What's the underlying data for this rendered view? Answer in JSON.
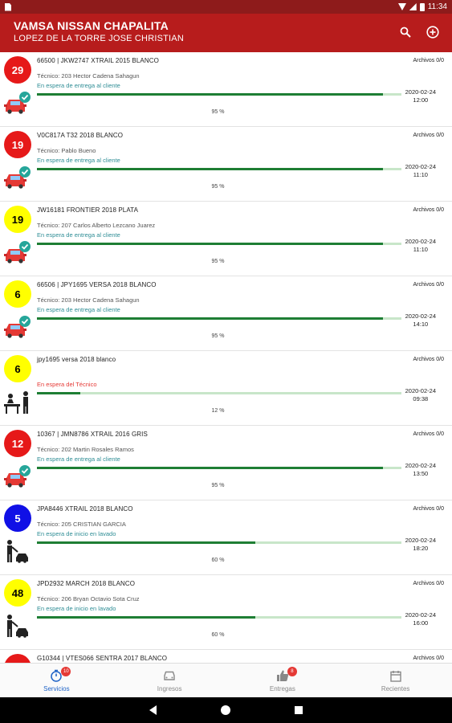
{
  "status_bar": {
    "time": "11:34"
  },
  "appbar": {
    "title": "VAMSA NISSAN CHAPALITA",
    "subtitle": "LOPEZ DE LA TORRE JOSE CHRISTIAN",
    "search_icon": "search-icon",
    "add_icon": "add-circle-icon"
  },
  "rows": [
    {
      "badge": "29",
      "badge_color": "#e61919",
      "vehicle": "66500  |  JKW2747 XTRAIL 2015 BLANCO",
      "tecnico": "Técnico: 203 Hector Cadena Sahagun",
      "estado": "En espera de entrega al cliente",
      "fecha": "2020-02-24",
      "hora": "12:00",
      "porcentaje": "95 %",
      "progress": 0.95,
      "archivos": "Archivos 0/0",
      "icon": "car-done-icon"
    },
    {
      "badge": "19",
      "badge_color": "#e61919",
      "vehicle": "V0C817A T32 2018 BLANCO",
      "tecnico": "Técnico: Pablo Bueno",
      "estado": "En espera de entrega al cliente",
      "fecha": "2020-02-24",
      "hora": "11:10",
      "porcentaje": "95 %",
      "progress": 0.95,
      "archivos": "Archivos 0/0",
      "icon": "car-done-icon"
    },
    {
      "badge": "19",
      "badge_color": "#ffff00",
      "vehicle": "JW16181 FRONTIER 2018 PLATA",
      "tecnico": "Técnico: 207 Carlos Alberto Lezcano Juarez",
      "estado": "En espera de entrega al cliente",
      "fecha": "2020-02-24",
      "hora": "11:10",
      "porcentaje": "95 %",
      "progress": 0.95,
      "archivos": "Archivos 0/0",
      "icon": "car-done-icon"
    },
    {
      "badge": "6",
      "badge_color": "#ffff00",
      "vehicle": "66506  |  JPY1695 VERSA 2018 BLANCO",
      "tecnico": "Técnico: 203 Hector Cadena Sahagun",
      "estado": "En espera de entrega al cliente",
      "fecha": "2020-02-24",
      "hora": "14:10",
      "porcentaje": "95 %",
      "progress": 0.95,
      "archivos": "Archivos 0/0",
      "icon": "car-done-icon"
    },
    {
      "badge": "6",
      "badge_color": "#ffff00",
      "vehicle": "jpy1695 versa 2018 blanco",
      "tecnico": "",
      "estado": "En espera del Técnico",
      "estado_red": true,
      "fecha": "2020-02-24",
      "hora": "09:38",
      "porcentaje": "12 %",
      "progress": 0.12,
      "archivos": "Archivos 0/0",
      "icon": "reception-desk-icon"
    },
    {
      "badge": "12",
      "badge_color": "#e61919",
      "vehicle": "10367  |  JMN8786 XTRAIL 2016 GRIS",
      "tecnico": "Técnico: 202 Martin Rosales Ramos",
      "estado": "En espera de entrega al cliente",
      "fecha": "2020-02-24",
      "hora": "13:50",
      "porcentaje": "95 %",
      "progress": 0.95,
      "archivos": "Archivos 0/0",
      "icon": "car-done-icon"
    },
    {
      "badge": "5",
      "badge_color": "#1010e6",
      "vehicle": "JPA8446 XTRAIL 2018 BLANCO",
      "tecnico": "Técnico: 205 CRISTIAN GARCIA",
      "estado": "En espera de inicio en lavado",
      "fecha": "2020-02-24",
      "hora": "18:20",
      "porcentaje": "60 %",
      "progress": 0.6,
      "archivos": "Archivos 0/0",
      "icon": "car-wash-icon"
    },
    {
      "badge": "48",
      "badge_color": "#ffff00",
      "vehicle": "JPD2932 MARCH 2018 BLANCO",
      "tecnico": "Técnico: 206 Bryan Octavio Sota Cruz",
      "estado": "En espera de inicio en lavado",
      "fecha": "2020-02-24",
      "hora": "16:00",
      "porcentaje": "60 %",
      "progress": 0.6,
      "archivos": "Archivos 0/0",
      "icon": "car-wash-icon"
    },
    {
      "badge": "",
      "badge_color": "#e61919",
      "vehicle": "G10344  |  VTES066 SENTRA 2017 BLANCO",
      "tecnico": "",
      "estado": "",
      "fecha": "",
      "hora": "",
      "porcentaje": "",
      "progress": 0,
      "archivos": "Archivos 0/0",
      "icon": "car-done-icon"
    }
  ],
  "bottom_nav": [
    {
      "label": "Servicios",
      "icon": "stopwatch-icon",
      "badge": "10",
      "active": true
    },
    {
      "label": "Ingresos",
      "icon": "car-icon",
      "badge": "",
      "active": false
    },
    {
      "label": "Entregas",
      "icon": "thumbs-up-icon",
      "badge": "8",
      "active": false
    },
    {
      "label": "Recientes",
      "icon": "calendar-icon",
      "badge": "",
      "active": false
    }
  ],
  "colors": {
    "primary": "#b71c1c",
    "status_bar": "#8e1b1b",
    "progress": "#1e7e34",
    "progress_track": "#c8e6c9",
    "active_tab": "#1e62c6"
  }
}
